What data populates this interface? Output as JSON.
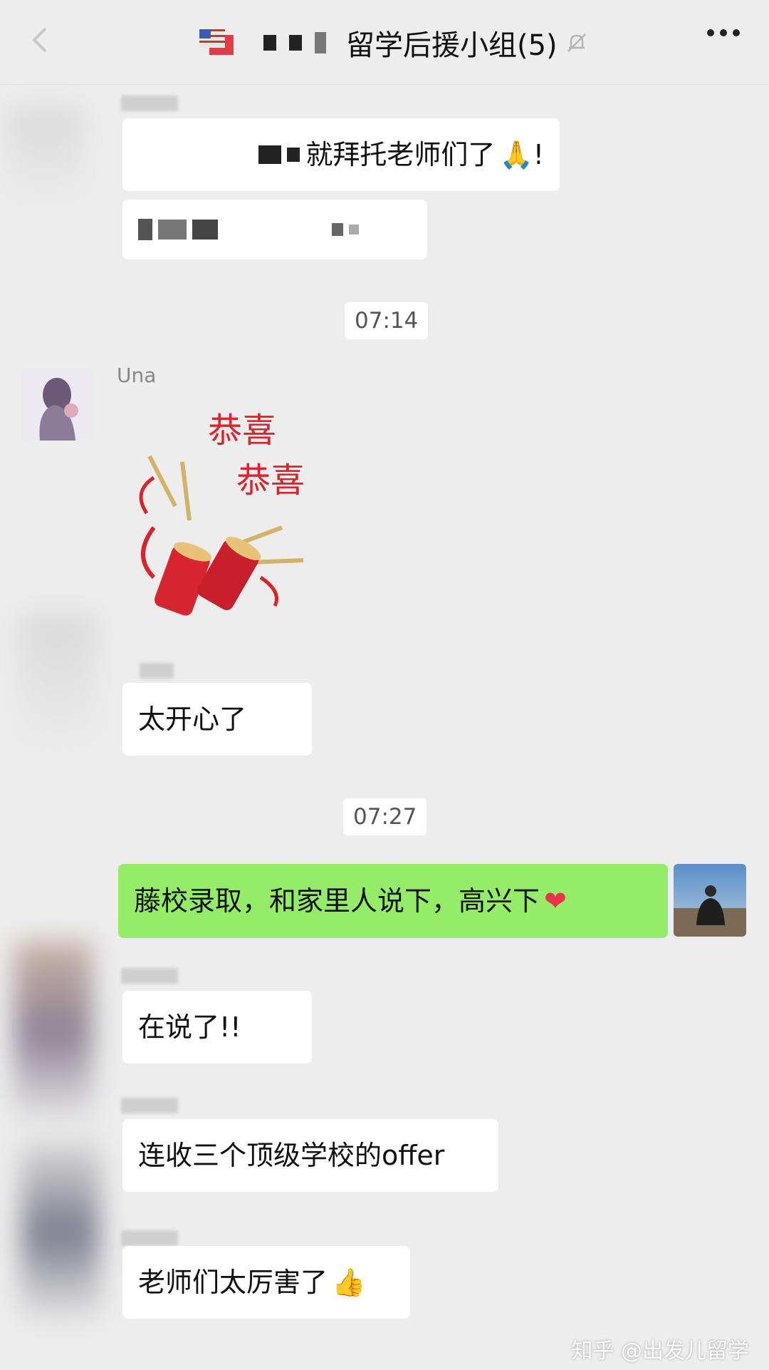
{
  "header": {
    "title": "留学后援小组(5)",
    "back_icon": "back-arrow-icon",
    "mute_icon": "bell-muted-icon",
    "more_icon": "more-dots-icon"
  },
  "messages": {
    "m1": "就拜托老师们了",
    "m1_suffix": "!",
    "t1": "07:14",
    "una_name": "Una",
    "sticker_text_1": "恭喜",
    "sticker_text_2": "恭喜",
    "m3": "太开心了",
    "t2": "07:27",
    "m4": "藤校录取，和家里人说下，高兴下",
    "m5": "在说了!!",
    "m6": "连收三个顶级学校的offer",
    "m7": "老师们太厉害了"
  },
  "watermark": "知乎 @出发儿留学",
  "colors": {
    "background": "#ededed",
    "self_bubble": "#95ec69",
    "other_bubble": "#ffffff"
  }
}
